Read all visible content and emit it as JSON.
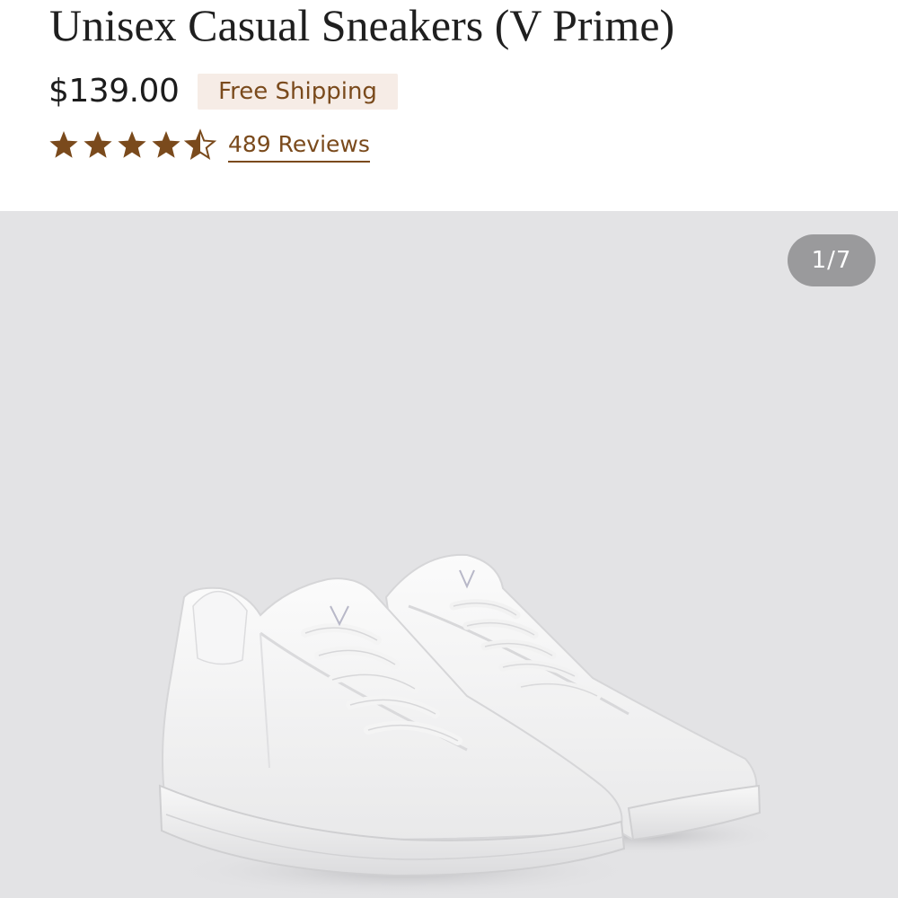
{
  "product": {
    "title": "Unisex Casual Sneakers (V Prime)",
    "price": "$139.00",
    "shipping_badge": "Free Shipping",
    "rating": 4.5,
    "rating_max": 5,
    "reviews_label": "489 Reviews"
  },
  "gallery": {
    "counter": "1/7",
    "current_index": 1,
    "total_images": 7,
    "image_subject": "white knit sneakers pair"
  },
  "colors": {
    "accent_brown": "#7a4a1c",
    "badge_bg": "#f6ece6",
    "gallery_bg": "#e3e3e5",
    "counter_bg": "#9a9a9c"
  }
}
